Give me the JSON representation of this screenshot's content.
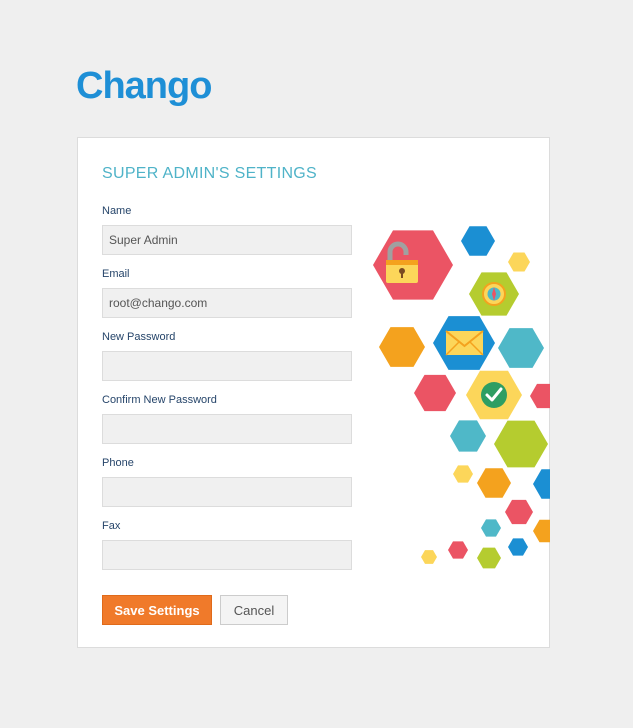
{
  "brand": {
    "logo_text": "Chango"
  },
  "settings": {
    "title": "SUPER ADMIN'S SETTINGS",
    "fields": {
      "name": {
        "label": "Name",
        "value": "Super Admin"
      },
      "email": {
        "label": "Email",
        "value": "root@chango.com"
      },
      "new_password": {
        "label": "New Password",
        "value": ""
      },
      "confirm_password": {
        "label": "Confirm New Password",
        "value": ""
      },
      "phone": {
        "label": "Phone",
        "value": ""
      },
      "fax": {
        "label": "Fax",
        "value": ""
      }
    },
    "buttons": {
      "save_label": "Save Settings",
      "cancel_label": "Cancel"
    }
  },
  "illustration": {
    "icons": [
      "lock-icon",
      "compass-icon",
      "envelope-icon",
      "checkmark-icon"
    ]
  },
  "colors": {
    "brand_blue": "#1e8fd6",
    "title_teal": "#4fb3c8",
    "label_navy": "#26456a",
    "save_orange": "#f07a2a",
    "page_bg": "#efefef",
    "hex_red": "#eb5464",
    "hex_blue": "#1b8fd3",
    "hex_yellow": "#fcd65a",
    "hex_green": "#b5cc2f",
    "hex_orange": "#f4a21e",
    "hex_teal": "#4fb8c8"
  }
}
